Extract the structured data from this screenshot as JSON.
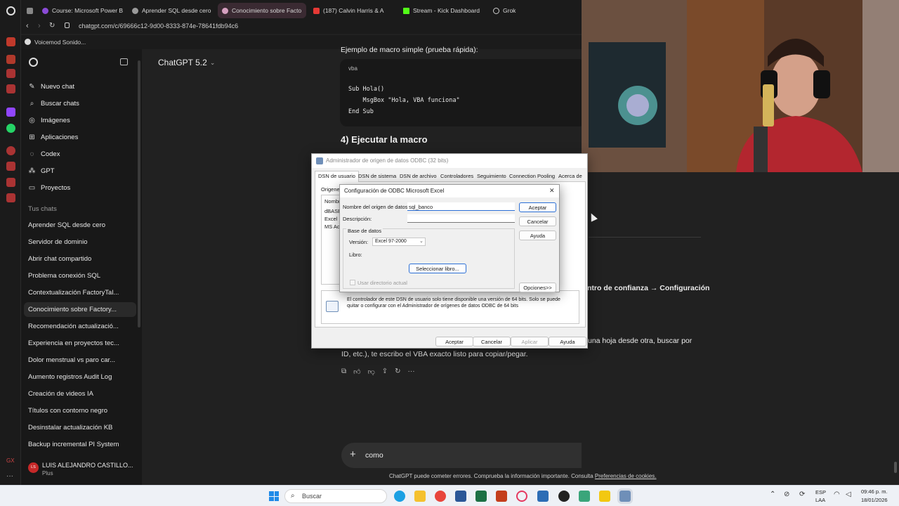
{
  "browser": {
    "tabs": [
      {
        "label": "Course: Microsoft Power B",
        "color": "#8a4bd6"
      },
      {
        "label": "Aprender SQL desde cero",
        "color": "#9a9a9a"
      },
      {
        "label": "Conocimiento sobre Facto",
        "color": "#9a9a9a",
        "active": true
      },
      {
        "label": "(187) Calvin Harris & A",
        "color": "#e53935"
      },
      {
        "label": "Stream - Kick Dashboard",
        "color": "#53fc18"
      },
      {
        "label": "Grok",
        "color": "#cfcfcf"
      }
    ],
    "url": "chatgpt.com/c/69666c12-9d00-8333-874e-78641fdb94c6",
    "bookmark": "Voicemod Sonido..."
  },
  "sidebar": {
    "nav": [
      {
        "label": "Nuevo chat",
        "icon": "edit-icon"
      },
      {
        "label": "Buscar chats",
        "icon": "search-icon"
      },
      {
        "label": "Imágenes",
        "icon": "image-icon"
      },
      {
        "label": "Aplicaciones",
        "icon": "apps-icon"
      },
      {
        "label": "Codex",
        "icon": "codex-icon"
      },
      {
        "label": "GPT",
        "icon": "gpt-icon"
      },
      {
        "label": "Proyectos",
        "icon": "folder-icon"
      }
    ],
    "section_label": "Tus chats",
    "chats": [
      "Aprender SQL desde cero",
      "Servidor de dominio",
      "Abrir chat compartido",
      "Problema conexión SQL",
      "Contextualización FactoryTal...",
      "Conocimiento sobre Factory...",
      "Recomendación actualizació...",
      "Experiencia en proyectos tec...",
      "Dolor menstrual vs paro car...",
      "Aumento registros Audit Log",
      "Creación de videos IA",
      "Títulos con contorno negro",
      "Desinstalar actualización KB",
      "Backup incremental PI System"
    ],
    "active_chat_index": 5,
    "user": {
      "initials": "LS",
      "name": "LUIS ALEJANDRO CASTILLO...",
      "plan": "Plus"
    }
  },
  "header": {
    "model": "ChatGPT 5.2"
  },
  "content": {
    "truncated_heading": "Ejemplo de macro simple (prueba rápida):",
    "code_lang": "vba",
    "code_lines": [
      "Sub Hola()",
      "    MsgBox \"Hola, VBA funciona\"",
      "End Sub"
    ],
    "section_heading": "4) Ejecutar la macro",
    "right_text_1": "ntro de confianza → Configuración",
    "right_text_2": "una hoja desde otra, buscar por",
    "paragraph_line2": "ID, etc.), te escribo el VBA exacto listo para copiar/pegar."
  },
  "composer": {
    "input_value": "como",
    "disclaimer": "ChatGPT puede cometer errores. Comprueba la información importante. Consulta",
    "disclaimer_link": "Preferencias de cookies."
  },
  "odbc_admin": {
    "title": "Administrador de origen de datos ODBC (32 bits)",
    "tabs": [
      "DSN de usuario",
      "DSN de sistema",
      "DSN de archivo",
      "Controladores",
      "Seguimiento",
      "Connection Pooling",
      "Acerca de"
    ],
    "group_label": "Origenes",
    "list_header": "Nombr",
    "list_items": [
      "dBASE",
      "Excel F",
      "MS Acc"
    ],
    "info_text": "El controlador de este DSN de usuario solo tiene disponible una versión de 64 bits. Solo se puede quitar o configurar con el Administrador de orígenes de datos ODBC de 64 bits",
    "buttons": {
      "accept": "Aceptar",
      "cancel": "Cancelar",
      "apply": "Aplicar",
      "help": "Ayuda"
    }
  },
  "excel_config": {
    "title": "Configuración de ODBC Microsoft Excel",
    "dsn_label": "Nombre del origen de datos:",
    "dsn_value": "sql_banco",
    "desc_label": "Descripción:",
    "desc_value": "",
    "db_group": "Base de datos",
    "version_label": "Versión:",
    "version_value": "Excel 97-2000",
    "book_label": "Libro:",
    "select_book": "Seleccionar libro...",
    "use_current_dir": "Usar directorio actual",
    "buttons": {
      "accept": "Aceptar",
      "cancel": "Cancelar",
      "help": "Ayuda",
      "options": "Opciones>>"
    }
  },
  "taskbar": {
    "search_placeholder": "Buscar",
    "lang": "ESP",
    "lang_sub": "LAA",
    "time": "09:46 p. m.",
    "date": "18/01/2026"
  }
}
